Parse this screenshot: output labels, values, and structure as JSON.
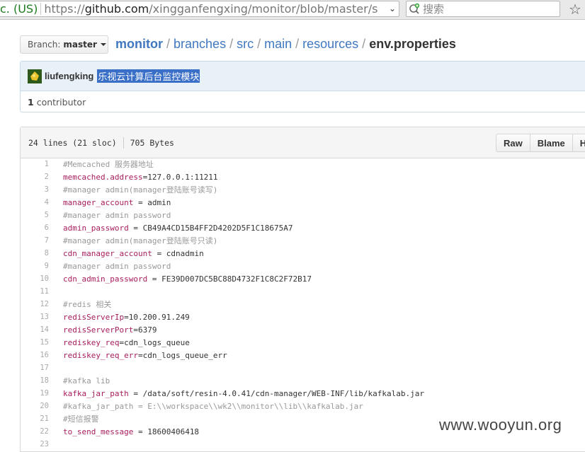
{
  "browser": {
    "url_ev": "c. (US)",
    "url_scheme": "https://",
    "url_host": "github.com",
    "url_path": "/xingganfengxing/monitor/blob/master/s",
    "search_placeholder": "搜索"
  },
  "breadcrumb": {
    "branch_label": "Branch:",
    "branch_name": "master",
    "repo": "monitor",
    "parts": [
      "branches",
      "src",
      "main",
      "resources"
    ],
    "file": "env.properties"
  },
  "commit": {
    "author": "liufengking",
    "message": "乐视云计算后台监控模块",
    "contributor_count": "1",
    "contributor_label": "contributor"
  },
  "file": {
    "lines_info": "24 lines (21 sloc)",
    "size": "705 Bytes",
    "buttons": [
      "Raw",
      "Blame",
      "H"
    ]
  },
  "code_lines": [
    {
      "n": "1",
      "type": "comment",
      "text": "#Memcached 服务器地址"
    },
    {
      "n": "2",
      "type": "kv",
      "key": "memcached.address",
      "rest": "=127.0.0.1:11211"
    },
    {
      "n": "3",
      "type": "comment",
      "text": "#manager admin(manager登陆账号读写)"
    },
    {
      "n": "4",
      "type": "kv",
      "key": "manager_account",
      "rest": " = admin"
    },
    {
      "n": "5",
      "type": "comment",
      "text": "#manager admin password"
    },
    {
      "n": "6",
      "type": "kv",
      "key": "admin_password",
      "rest": " = CB49A4CD15B4FF2D4202D5F1C18675A7"
    },
    {
      "n": "7",
      "type": "comment",
      "text": "#manager admin(manager登陆账号只读)"
    },
    {
      "n": "8",
      "type": "kv",
      "key": "cdn_manager_account",
      "rest": " = cdnadmin"
    },
    {
      "n": "9",
      "type": "comment",
      "text": "#manager admin password"
    },
    {
      "n": "10",
      "type": "kv",
      "key": "cdn_admin_password",
      "rest": " = FE39D007DC5BC88D4732F1C8C2F72B17"
    },
    {
      "n": "11",
      "type": "blank",
      "text": ""
    },
    {
      "n": "12",
      "type": "comment",
      "text": "#redis 相关"
    },
    {
      "n": "13",
      "type": "kv",
      "key": "redisServerIp",
      "rest": "=10.200.91.249"
    },
    {
      "n": "14",
      "type": "kv",
      "key": "redisServerPort",
      "rest": "=6379"
    },
    {
      "n": "15",
      "type": "kv",
      "key": "rediskey_req",
      "rest": "=cdn_logs_queue"
    },
    {
      "n": "16",
      "type": "kv",
      "key": "rediskey_req_err",
      "rest": "=cdn_logs_queue_err"
    },
    {
      "n": "17",
      "type": "blank",
      "text": ""
    },
    {
      "n": "18",
      "type": "comment",
      "text": "#kafka lib"
    },
    {
      "n": "19",
      "type": "kv",
      "key": "kafka_jar_path",
      "rest": " = /data/soft/resin-4.0.41/cdn-manager/WEB-INF/lib/kafkalab.jar"
    },
    {
      "n": "20",
      "type": "comment",
      "text": "#kafka_jar_path = E:\\\\workspace\\\\wk2\\\\monitor\\\\lib\\\\kafkalab.jar"
    },
    {
      "n": "21",
      "type": "comment",
      "text": "#短信报警"
    },
    {
      "n": "22",
      "type": "kv",
      "key": "to_send_message",
      "rest": " = 18600406418"
    },
    {
      "n": "23",
      "type": "blank",
      "text": ""
    }
  ],
  "watermark": "www.wooyun.org"
}
